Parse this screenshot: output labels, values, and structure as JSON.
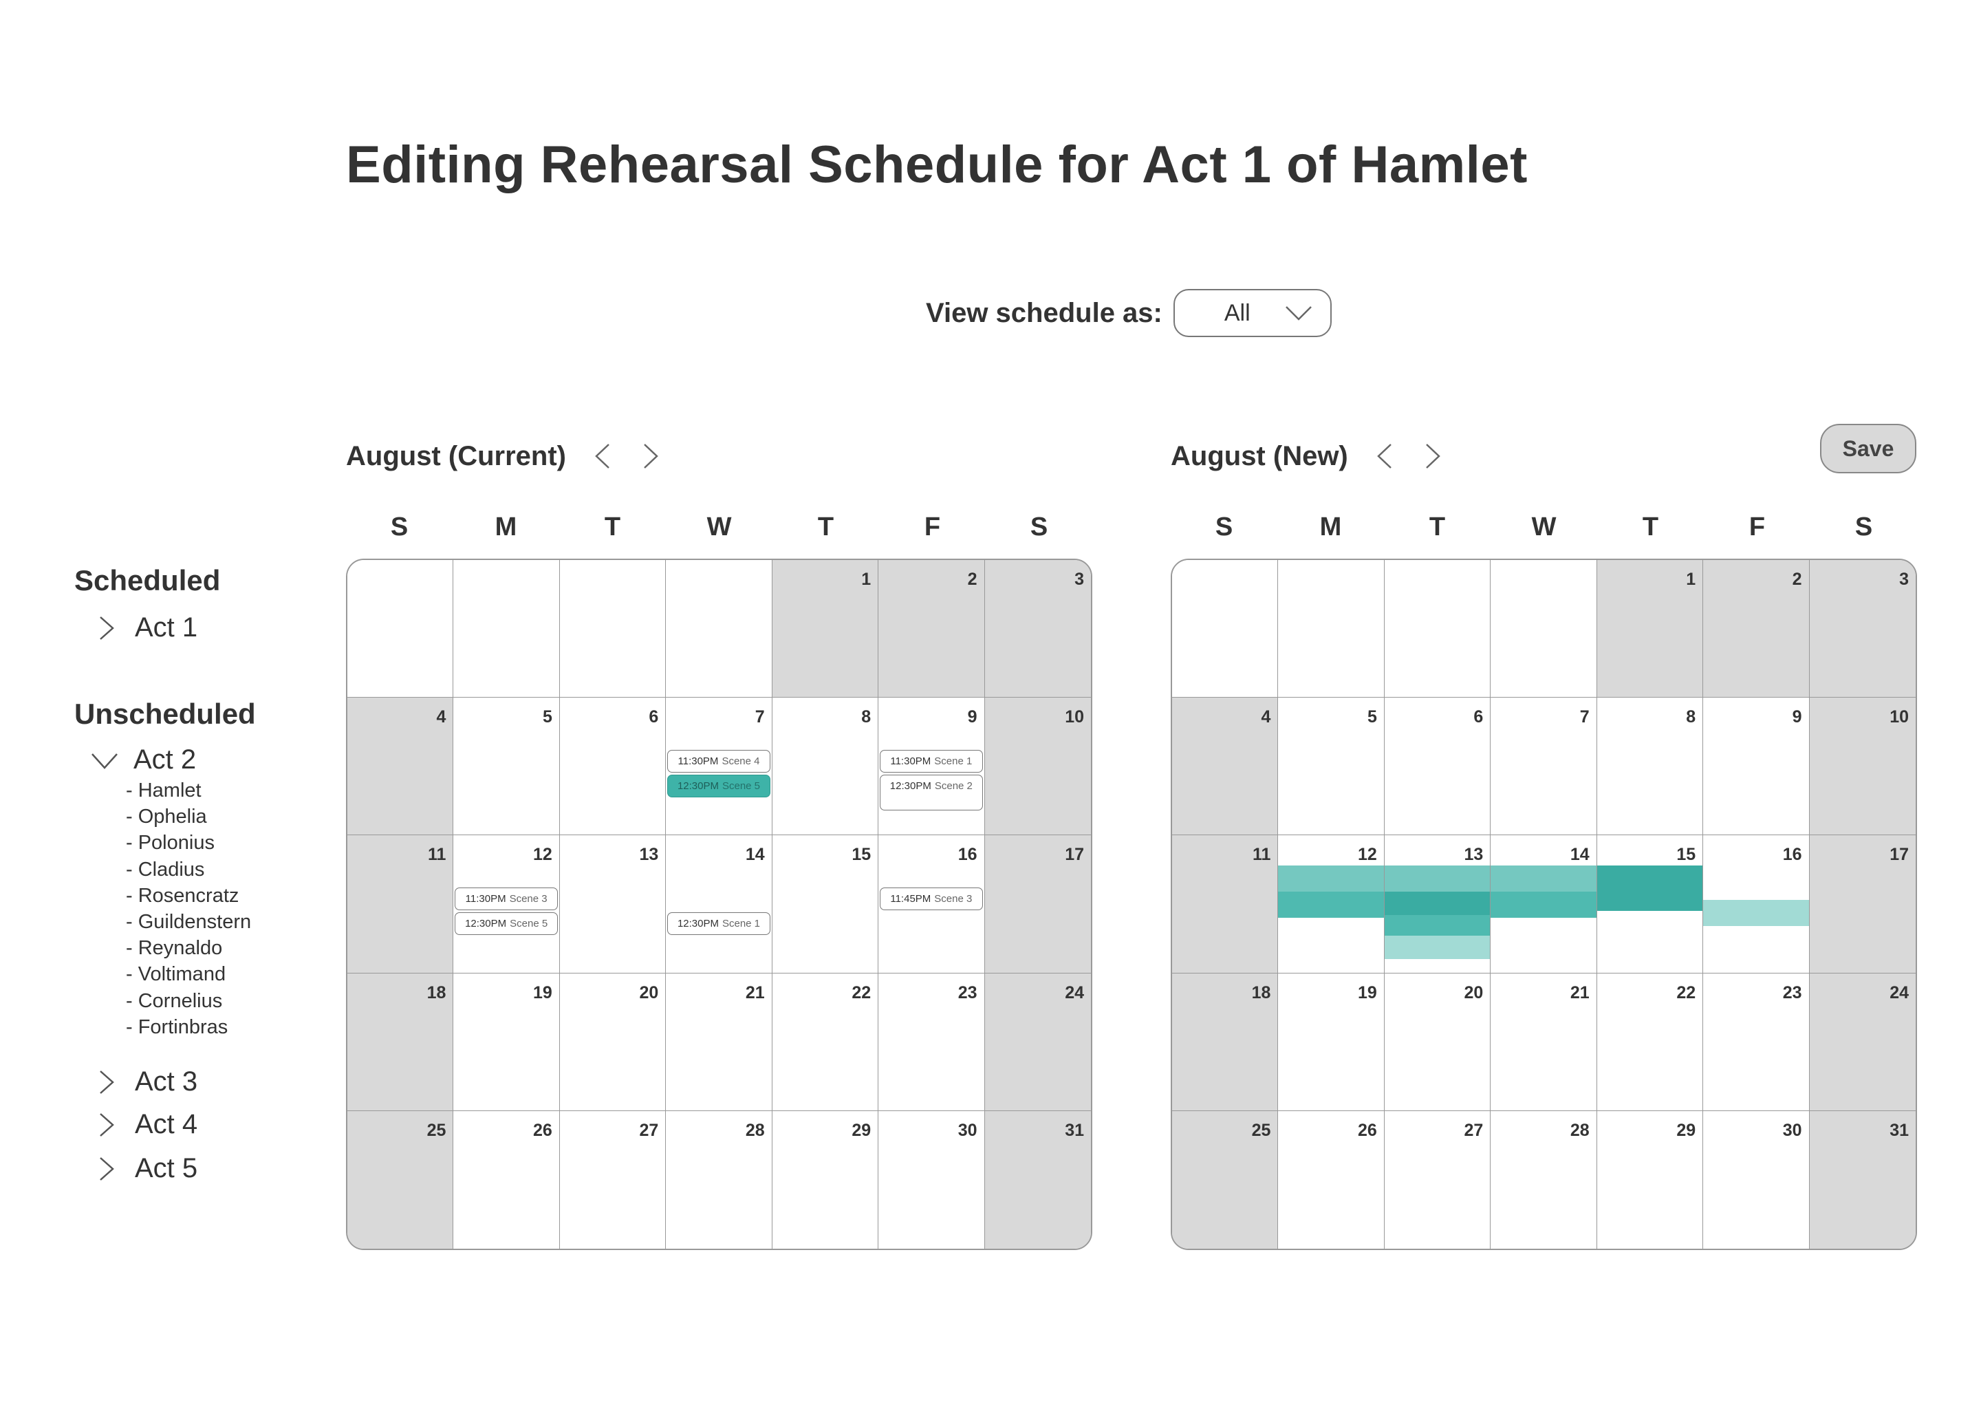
{
  "title": "Editing Rehearsal Schedule for Act 1 of Hamlet",
  "view_as": {
    "label": "View schedule as:",
    "value": "All"
  },
  "sidebar": {
    "scheduled_heading": "Scheduled",
    "scheduled_acts": [
      {
        "label": "Act 1",
        "expanded": false
      }
    ],
    "unscheduled_heading": "Unscheduled",
    "unscheduled_acts": [
      {
        "label": "Act 2",
        "expanded": true,
        "characters": [
          "- Hamlet",
          "- Ophelia",
          "- Polonius",
          "- Cladius",
          "- Rosencratz",
          "- Guildenstern",
          "- Reynaldo",
          "- Voltimand",
          "- Cornelius",
          "- Fortinbras"
        ]
      },
      {
        "label": "Act 3",
        "expanded": false
      },
      {
        "label": "Act 4",
        "expanded": false
      },
      {
        "label": "Act 5",
        "expanded": false
      }
    ]
  },
  "save_label": "Save",
  "colors": {
    "selected_event": "#3eb3a8",
    "teal_light": "#75c8c0",
    "teal_mid": "#4fbab0",
    "teal_dark": "#3aaca2",
    "teal_pale": "#a2dbd5",
    "weekend_gray": "#d9d9d9"
  },
  "days_of_week": [
    "S",
    "M",
    "T",
    "W",
    "T",
    "F",
    "S"
  ],
  "calendars": [
    {
      "title": "August (Current)",
      "weeks": [
        [
          "",
          "",
          "",
          "",
          "1",
          "2",
          "3"
        ],
        [
          "4",
          "5",
          "6",
          "7",
          "8",
          "9",
          "10"
        ],
        [
          "11",
          "12",
          "13",
          "14",
          "15",
          "16",
          "17"
        ],
        [
          "18",
          "19",
          "20",
          "21",
          "22",
          "23",
          "24"
        ],
        [
          "25",
          "26",
          "27",
          "28",
          "29",
          "30",
          "31"
        ]
      ],
      "events": [
        {
          "day": "7",
          "time": "11:30PM",
          "scene": "Scene 4",
          "selected": false
        },
        {
          "day": "7",
          "time": "12:30PM",
          "scene": "Scene 5",
          "selected": true
        },
        {
          "day": "9",
          "time": "11:30PM",
          "scene": "Scene 1",
          "selected": false
        },
        {
          "day": "9",
          "time": "12:30PM",
          "scene": "Scene 2",
          "selected": false
        },
        {
          "day": "12",
          "time": "11:30PM",
          "scene": "Scene 3",
          "selected": false
        },
        {
          "day": "12",
          "time": "12:30PM",
          "scene": "Scene 5",
          "selected": false
        },
        {
          "day": "14",
          "time": "12:30PM",
          "scene": "Scene 1",
          "selected": false
        },
        {
          "day": "16",
          "time": "11:45PM",
          "scene": "Scene 3",
          "selected": false
        }
      ]
    },
    {
      "title": "August (New)",
      "weeks": [
        [
          "",
          "",
          "",
          "",
          "1",
          "2",
          "3"
        ],
        [
          "4",
          "5",
          "6",
          "7",
          "8",
          "9",
          "10"
        ],
        [
          "11",
          "12",
          "13",
          "14",
          "15",
          "16",
          "17"
        ],
        [
          "18",
          "19",
          "20",
          "21",
          "22",
          "23",
          "24"
        ],
        [
          "25",
          "26",
          "27",
          "28",
          "29",
          "30",
          "31"
        ]
      ],
      "availability": [
        {
          "day": "12",
          "shade": "teal_light"
        },
        {
          "day": "12",
          "shade": "teal_mid"
        },
        {
          "day": "13",
          "shade": "teal_light"
        },
        {
          "day": "13",
          "shade": "teal_dark"
        },
        {
          "day": "13",
          "shade": "teal_mid"
        },
        {
          "day": "13",
          "shade": "teal_pale"
        },
        {
          "day": "14",
          "shade": "teal_light"
        },
        {
          "day": "14",
          "shade": "teal_mid"
        },
        {
          "day": "15",
          "shade": "teal_dark"
        },
        {
          "day": "16",
          "shade": "teal_pale"
        }
      ]
    }
  ]
}
